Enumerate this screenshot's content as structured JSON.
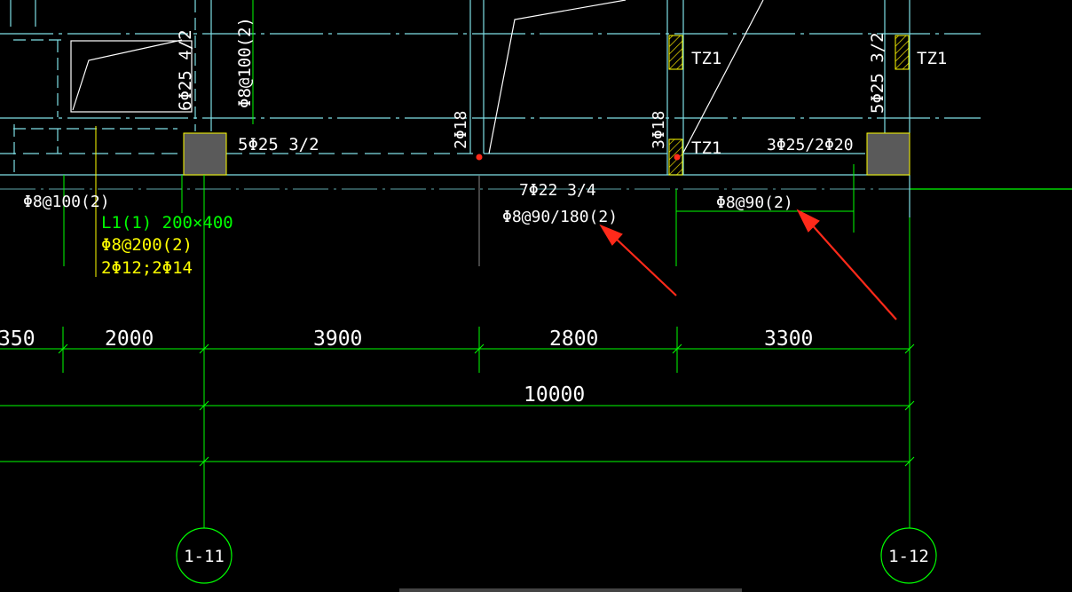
{
  "colors": {
    "background": "#000000",
    "cyan": "#7fe0e6",
    "green": "#00ff00",
    "yellow": "#ffff00",
    "white": "#ffffff",
    "red": "#ff2a1a",
    "column_fill": "#5a5a5a",
    "hatch_yellow": "#e0d000"
  },
  "labels": {
    "left_beam_top_rebar": "5Φ25  3/2",
    "left_col_vertical_rebar": "6Φ25  4/2",
    "left_col_stirrup": "Φ8@100(2)",
    "left_stirrup": "Φ8@100(2)",
    "l1_beam_name": "L1(1)  200×400",
    "l1_stirrup": "Φ8@200(2)",
    "l1_rebar": "2Φ12;2Φ14",
    "mid_left_vertical": "2Φ18",
    "mid_right_vertical": "3Φ18",
    "tz1_top_mid": "TZ1",
    "tz1_top_right": "TZ1",
    "tz1_lower": "TZ1",
    "right_beam_rebar": "3Φ25/2Φ20",
    "right_col_vertical": "5Φ25  3/2",
    "mid_bottom_rebar": "7Φ22  3/4",
    "mid_stirrup": "Φ8@90/180(2)",
    "right_stirrup": "Φ8@90(2)"
  },
  "dimensions": {
    "row1": [
      "350",
      "2000",
      "3900",
      "2800",
      "3300"
    ],
    "total": "10000"
  },
  "axes": {
    "left": "1-11",
    "right": "1-12"
  }
}
